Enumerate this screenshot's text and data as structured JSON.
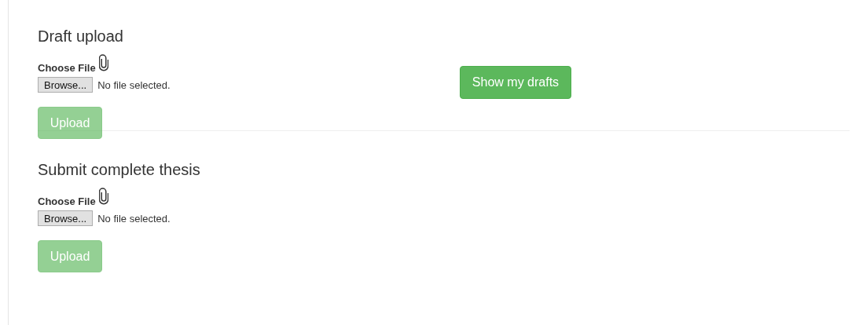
{
  "sections": [
    {
      "title": "Draft upload",
      "file_label": "Choose File",
      "browse_button": "Browse...",
      "file_status": "No file selected.",
      "upload_button": {
        "label": "Upload",
        "disabled": true
      },
      "side_button": "Show my drafts"
    },
    {
      "title": "Submit complete thesis",
      "file_label": "Choose File",
      "browse_button": "Browse...",
      "file_status": "No file selected.",
      "upload_button": {
        "label": "Upload",
        "disabled": true
      }
    }
  ]
}
